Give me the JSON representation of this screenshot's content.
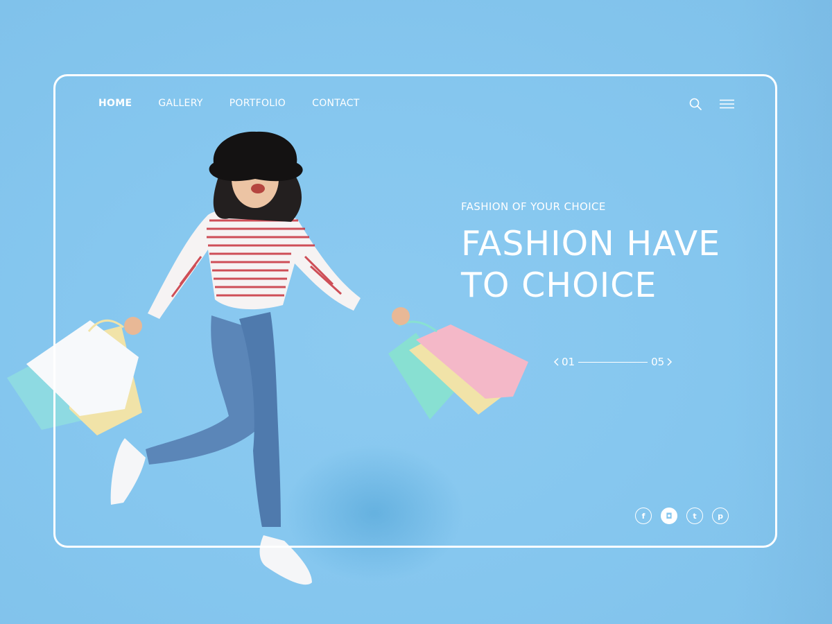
{
  "nav": {
    "items": [
      {
        "label": "HOME",
        "active": true
      },
      {
        "label": "GALLERY",
        "active": false
      },
      {
        "label": "PORTFOLIO",
        "active": false
      },
      {
        "label": "CONTACT",
        "active": false
      }
    ]
  },
  "header_icons": [
    "search-icon",
    "hamburger-menu-icon"
  ],
  "hero": {
    "subtitle": "FASHION OF YOUR CHOICE",
    "title": "FASHION HAVE TO CHOICE"
  },
  "pager": {
    "current": "01",
    "total": "05"
  },
  "social": [
    {
      "name": "facebook-icon",
      "glyph": "f"
    },
    {
      "name": "instagram-icon",
      "glyph": "◘"
    },
    {
      "name": "twitter-icon",
      "glyph": "t"
    },
    {
      "name": "pinterest-icon",
      "glyph": "p"
    }
  ],
  "colors": {
    "background": "#86c7ef",
    "foreground": "#ffffff",
    "bag_pink": "#f4b8c8",
    "bag_teal": "#88e0d2",
    "bag_yellow": "#f1e3a8",
    "shirt_stripe": "#c8323c",
    "jeans": "#5b86b8"
  }
}
